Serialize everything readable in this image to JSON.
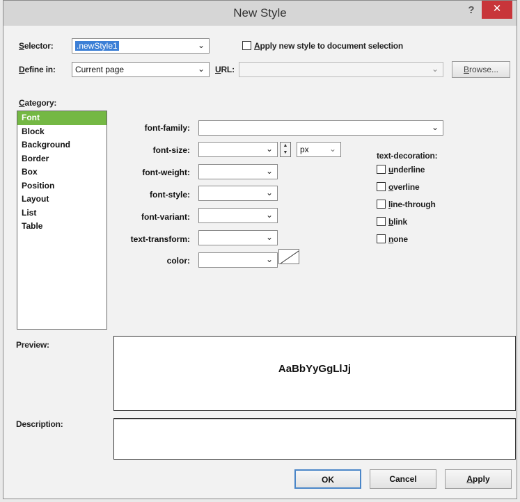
{
  "window": {
    "title": "New Style",
    "help_label": "?",
    "close_label": "✕"
  },
  "selector": {
    "label_prefix": "S",
    "label_rest": "elector:",
    "value": ".newStyle1"
  },
  "apply_new_style": {
    "label_prefix": "A",
    "label_rest": "pply new style to document selection",
    "checked": false
  },
  "define_in": {
    "label_prefix": "D",
    "label_rest": "efine in:",
    "value": "Current page"
  },
  "url": {
    "label_prefix": "U",
    "label_rest": "RL:",
    "value": ""
  },
  "browse_button": {
    "label_prefix": "B",
    "label_rest": "rowse..."
  },
  "category": {
    "label_prefix": "C",
    "label_rest": "ategory:",
    "items": [
      "Font",
      "Block",
      "Background",
      "Border",
      "Box",
      "Position",
      "Layout",
      "List",
      "Table"
    ],
    "selected": "Font"
  },
  "font": {
    "family_label": "font-family:",
    "family_value": "",
    "size_label": "font-size:",
    "size_value": "",
    "size_unit": "px",
    "weight_label": "font-weight:",
    "style_label": "font-style:",
    "variant_label": "font-variant:",
    "transform_label": "text-transform:",
    "color_label": "color:"
  },
  "text_decoration": {
    "label": "text-decoration:",
    "options": [
      {
        "prefix": "u",
        "rest": "nderline"
      },
      {
        "prefix": "o",
        "rest": "verline"
      },
      {
        "prefix": "l",
        "rest": "ine-through"
      },
      {
        "prefix": "b",
        "rest": "link"
      },
      {
        "prefix": "n",
        "rest": "one"
      }
    ]
  },
  "preview": {
    "label": "Preview:",
    "sample": "AaBbYyGgLlJj"
  },
  "description": {
    "label": "Description:",
    "text": ""
  },
  "buttons": {
    "ok": "OK",
    "cancel": "Cancel",
    "apply_prefix": "A",
    "apply_rest": "pply"
  },
  "colors": {
    "selected_item": "#74b844",
    "close_button": "#c8353a",
    "selector_highlight": "#3c7fd6"
  }
}
